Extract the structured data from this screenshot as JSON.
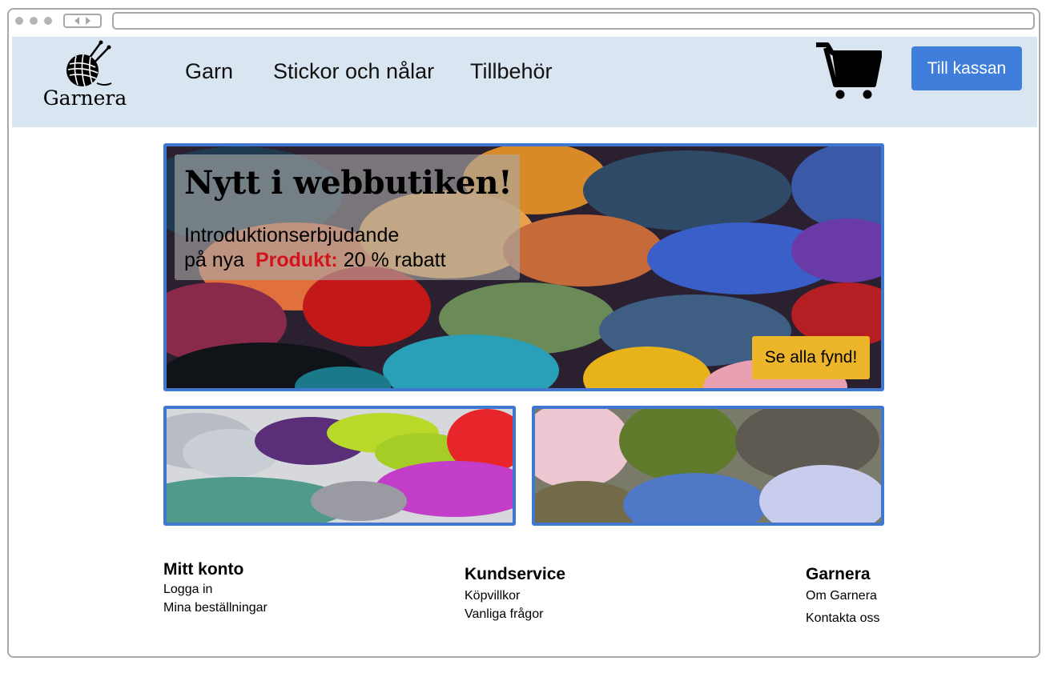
{
  "header": {
    "logo_text": "Garnera",
    "nav": [
      "Garn",
      "Stickor och nålar",
      "Tillbehör"
    ],
    "checkout_label": "Till kassan",
    "cart_icon": "shopping-cart-icon"
  },
  "hero": {
    "title": "Nytt i webbutiken!",
    "subtitle_line1": "Introduktionserbjudande",
    "subtitle_prefix": "på nya",
    "subtitle_highlight": "Produkt:",
    "subtitle_suffix": "20 % rabatt",
    "deals_label": "Se alla fynd!"
  },
  "footer": {
    "account": {
      "title": "Mitt konto",
      "links": [
        "Logga in",
        "Mina beställningar"
      ]
    },
    "service": {
      "title": "Kundservice",
      "links": [
        "Köpvillkor",
        "Vanliga frågor"
      ]
    },
    "company": {
      "title": "Garnera",
      "links": [
        "Om Garnera",
        "Kontakta oss"
      ]
    }
  },
  "colors": {
    "header_bg": "#d9e5f1",
    "accent_blue": "#3f7fdb",
    "frame_blue": "#3f77d1",
    "deals_yellow": "#ecb52a",
    "highlight_red": "#d3141b"
  }
}
